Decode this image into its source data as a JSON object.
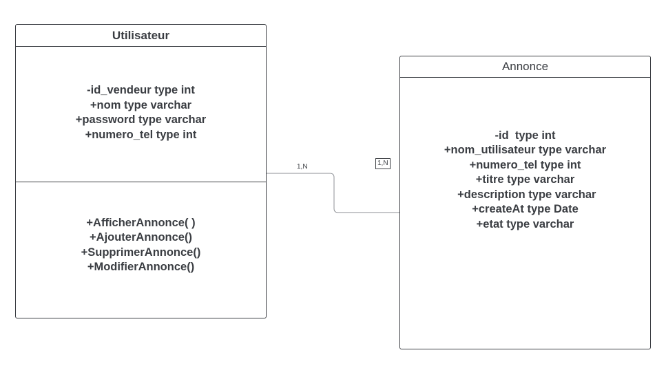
{
  "classes": {
    "utilisateur": {
      "name": "Utilisateur",
      "attributes": [
        "-id_vendeur type int",
        "+nom type varchar",
        "+password type varchar",
        "+numero_tel type int"
      ],
      "methods": [
        "+AfficherAnnonce( )",
        "+AjouterAnnonce()",
        "+SupprimerAnnonce()",
        "+ModifierAnnonce()"
      ]
    },
    "annonce": {
      "name": "Annonce",
      "attributes": [
        "-id  type int",
        "+nom_utilisateur type varchar",
        "+numero_tel type int",
        "+titre type varchar",
        " +description type varchar",
        "+createAt type Date",
        "+etat type varchar"
      ]
    }
  },
  "association": {
    "left_multiplicity": "1,N",
    "right_multiplicity": "1,N"
  },
  "colors": {
    "stroke": "#3a3d42",
    "connector": "#8c8f94",
    "background": "#ffffff"
  }
}
